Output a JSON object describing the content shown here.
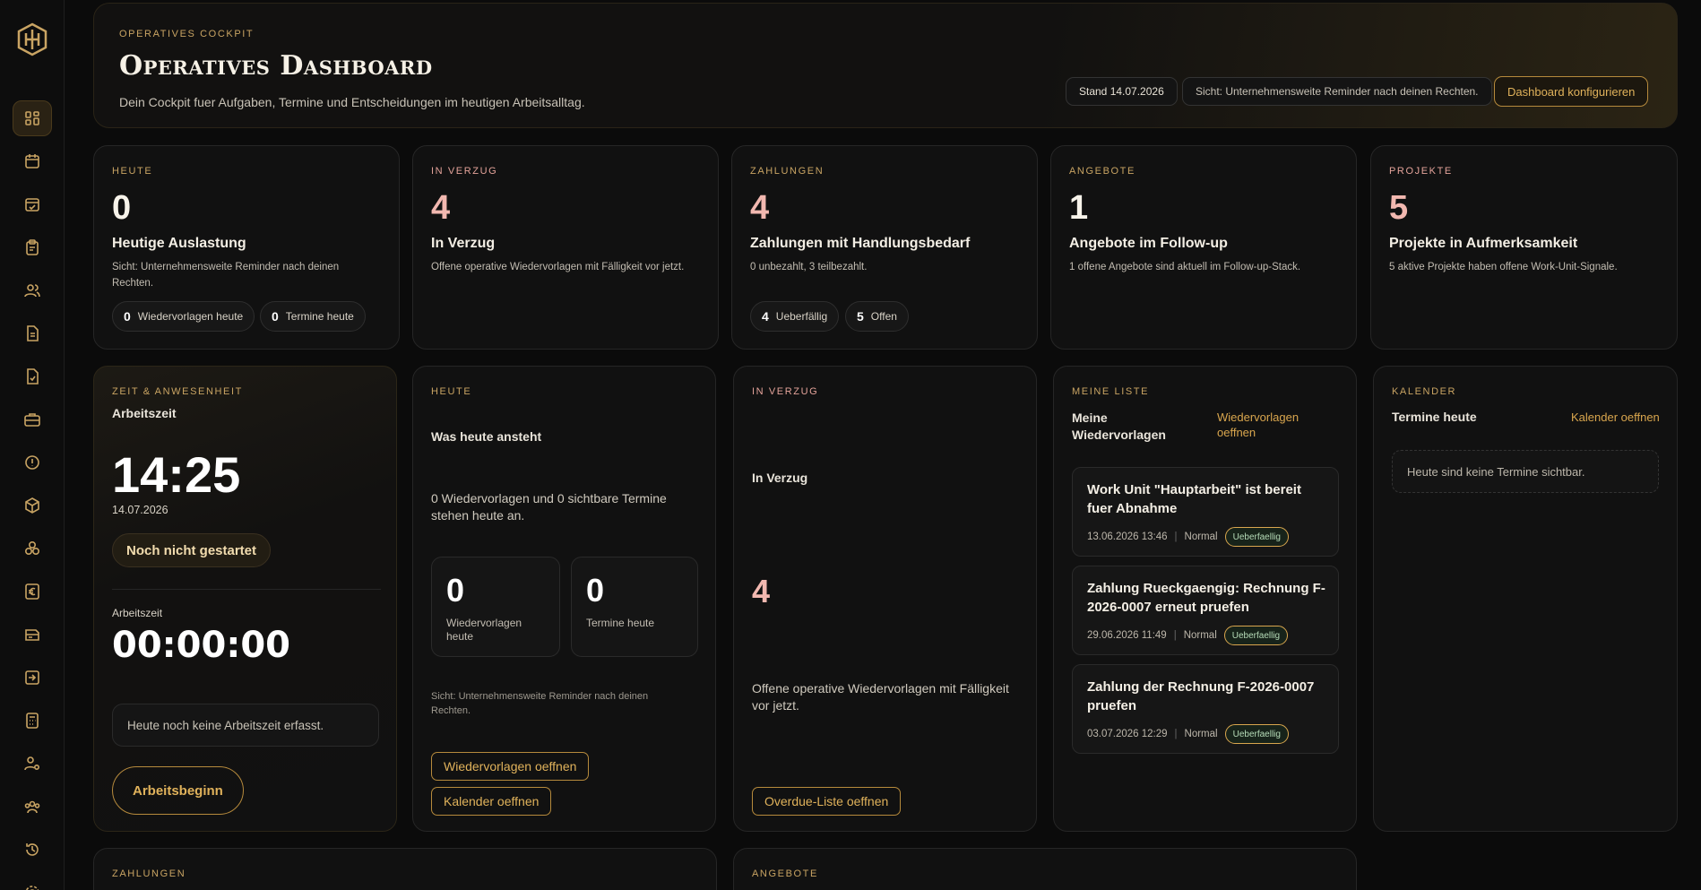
{
  "hero": {
    "eyebrow": "Operatives Cockpit",
    "title": "Operatives Dashboard",
    "subtitle": "Dein Cockpit fuer Aufgaben, Termine und Entscheidungen im heutigen Arbeitsalltag.",
    "stand": "Stand 14.07.2026",
    "scope": "Sicht: Unternehmensweite Reminder nach deinen Rechten.",
    "configure_label": "Dashboard konfigurieren"
  },
  "stats": [
    {
      "eyebrow": "Heute",
      "value": "0",
      "title": "Heutige Auslastung",
      "desc": "Sicht: Unternehmensweite Reminder nach deinen Rechten.",
      "chips": [
        {
          "value": "0",
          "label": "Wiedervorlagen heute"
        },
        {
          "value": "0",
          "label": "Termine heute"
        }
      ]
    },
    {
      "eyebrow": "In Verzug",
      "value": "4",
      "title": "In Verzug",
      "desc": "Offene operative Wiedervorlagen mit Fälligkeit vor jetzt."
    },
    {
      "eyebrow": "Zahlungen",
      "value": "4",
      "title": "Zahlungen mit Handlungsbedarf",
      "desc": "0 unbezahlt, 3 teilbezahlt.",
      "chips": [
        {
          "value": "4",
          "label": "Ueberfällig"
        },
        {
          "value": "5",
          "label": "Offen"
        }
      ]
    },
    {
      "eyebrow": "Angebote",
      "value": "1",
      "title": "Angebote im Follow-up",
      "desc": "1 offene Angebote sind aktuell im Follow-up-Stack."
    },
    {
      "eyebrow": "Projekte",
      "value": "5",
      "title": "Projekte in Aufmerksamkeit",
      "desc": "5 aktive Projekte haben offene Work-Unit-Signale."
    }
  ],
  "time": {
    "eyebrow": "Zeit & Anwesenheit",
    "label": "Arbeitszeit",
    "clock": "14:25",
    "date": "14.07.2026",
    "status": "Noch nicht gestartet",
    "worktime_label": "Arbeitszeit",
    "worktime": "00:00:00",
    "empty": "Heute noch keine Arbeitszeit erfasst.",
    "start_label": "Arbeitsbeginn"
  },
  "today": {
    "eyebrow": "Heute",
    "title": "Was heute ansteht",
    "summary": "0 Wiedervorlagen und 0 sichtbare Termine stehen heute an.",
    "box1_value": "0",
    "box1_label": "Wiedervorlagen heute",
    "box2_value": "0",
    "box2_label": "Termine heute",
    "scope": "Sicht: Unternehmensweite Reminder nach deinen Rechten.",
    "btn1": "Wiedervorlagen oeffnen",
    "btn2": "Kalender oeffnen"
  },
  "overdue": {
    "eyebrow": "In Verzug",
    "title": "In Verzug",
    "value": "4",
    "desc": "Offene operative Wiedervorlagen mit Fälligkeit vor jetzt.",
    "btn": "Overdue-Liste oeffnen"
  },
  "mylist": {
    "eyebrow": "Meine Liste",
    "title": "Meine Wiedervorlagen",
    "link": "Wiedervorlagen oeffnen",
    "items": [
      {
        "title": "Work Unit \"Hauptarbeit\" ist bereit fuer Abnahme",
        "date": "13.06.2026 13:46",
        "priority": "Normal",
        "badge": "Ueberfaellig"
      },
      {
        "title": "Zahlung Rueckgaengig: Rechnung F-2026-0007 erneut pruefen",
        "date": "29.06.2026 11:49",
        "priority": "Normal",
        "badge": "Ueberfaellig"
      },
      {
        "title": "Zahlung der Rechnung F-2026-0007 pruefen",
        "date": "03.07.2026 12:29",
        "priority": "Normal",
        "badge": "Ueberfaellig"
      }
    ]
  },
  "calendar": {
    "eyebrow": "Kalender",
    "title": "Termine heute",
    "link": "Kalender oeffnen",
    "empty": "Heute sind keine Termine sichtbar."
  },
  "bottom": {
    "payments_eyebrow": "Zahlungen",
    "offers_eyebrow": "Angebote"
  }
}
